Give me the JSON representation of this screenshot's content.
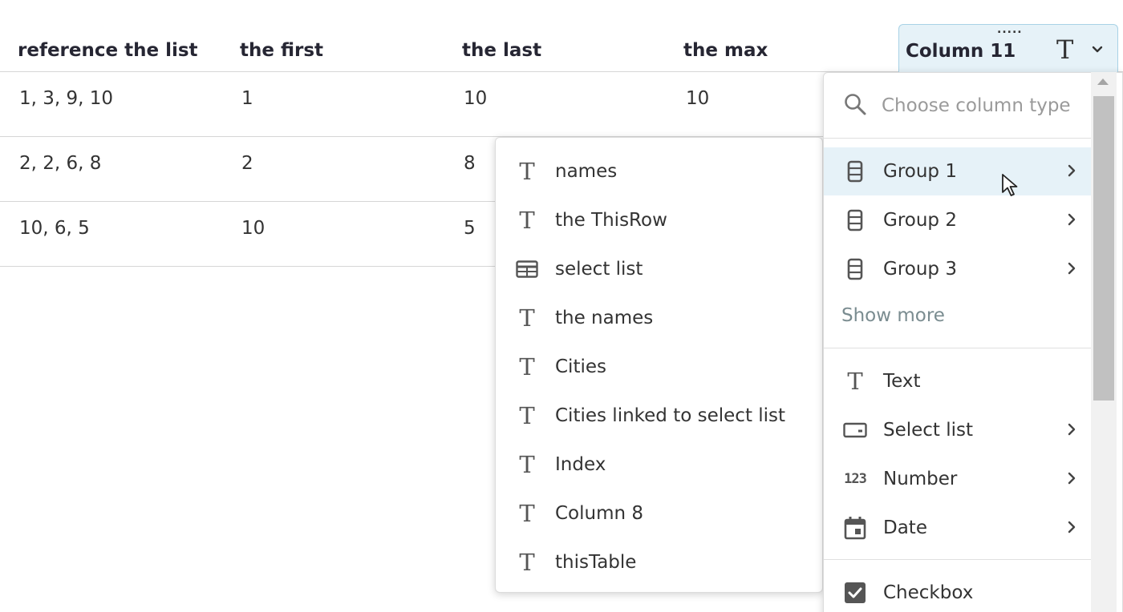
{
  "table": {
    "headers": [
      "reference the list",
      "the first",
      "the last",
      "the max"
    ],
    "rows": [
      [
        "1, 3, 9, 10",
        "1",
        "10",
        "10"
      ],
      [
        "2, 2, 6, 8",
        "2",
        "8",
        ""
      ],
      [
        "10, 6, 5",
        "10",
        "5",
        ""
      ]
    ],
    "active_column": {
      "title": "Column 11",
      "type_icon": "T",
      "drag_handle": "....."
    }
  },
  "column_menu": {
    "items": [
      {
        "label": "names",
        "icon": "text-type-icon"
      },
      {
        "label": "the ThisRow",
        "icon": "text-type-icon"
      },
      {
        "label": "select list",
        "icon": "table-icon"
      },
      {
        "label": "the names",
        "icon": "text-type-icon"
      },
      {
        "label": "Cities",
        "icon": "text-type-icon"
      },
      {
        "label": "Cities linked to select list",
        "icon": "text-type-icon"
      },
      {
        "label": "Index",
        "icon": "text-type-icon"
      },
      {
        "label": "Column 8",
        "icon": "text-type-icon"
      },
      {
        "label": "thisTable",
        "icon": "text-type-icon"
      }
    ]
  },
  "type_menu": {
    "search_placeholder": "Choose column type",
    "groups": [
      {
        "label": "Group 1",
        "icon": "group-icon"
      },
      {
        "label": "Group 2",
        "icon": "group-icon"
      },
      {
        "label": "Group 3",
        "icon": "group-icon"
      }
    ],
    "show_more": "Show more",
    "types": [
      {
        "label": "Text",
        "icon": "text-type-icon"
      },
      {
        "label": "Select list",
        "icon": "select-list-icon"
      },
      {
        "label": "Number",
        "icon": "number-icon",
        "icon_text": "123"
      },
      {
        "label": "Date",
        "icon": "calendar-icon"
      },
      {
        "label": "Checkbox",
        "icon": "checkbox-icon"
      }
    ]
  },
  "colors": {
    "accent_bg": "#e6f2f8",
    "accent_border": "#a8d2e6"
  }
}
